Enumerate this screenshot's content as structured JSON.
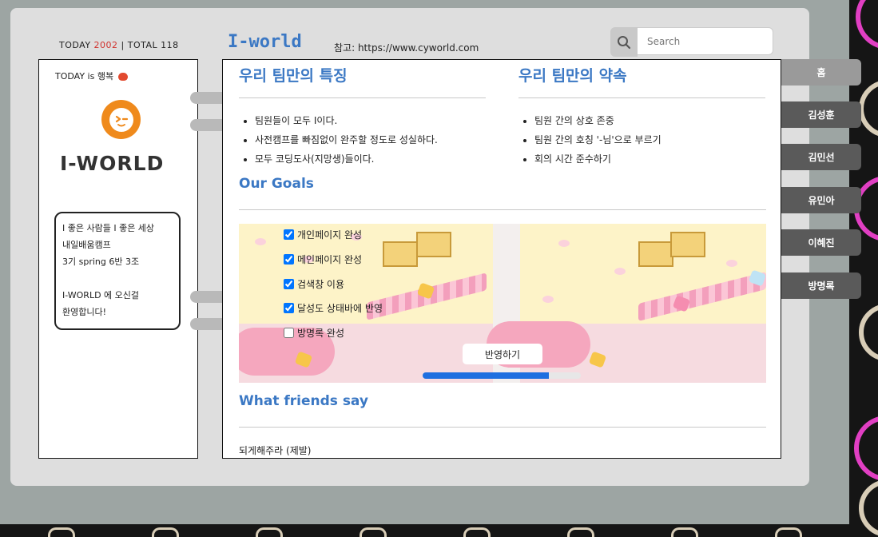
{
  "header": {
    "today_label": "TODAY",
    "today_count": "2002",
    "separator": "|",
    "total_label": "TOTAL",
    "total_count": "118",
    "site_title": "I-world",
    "reference": "참고: https://www.cyworld.com"
  },
  "search": {
    "placeholder": "Search",
    "icon": "search-icon"
  },
  "left_panel": {
    "today_mood": "TODAY is 행복",
    "logo_text": "I-WORLD",
    "intro_lines": [
      "I 좋은 사람들 I 좋은 세상",
      "내일배움캠프",
      "3기 spring 6반 3조",
      "",
      "I-WORLD 에 오신걸",
      "환영합니다!"
    ]
  },
  "main": {
    "feature_title": "우리 팀만의 특징",
    "features": [
      "팀원들이 모두 I이다.",
      "사전캠프를 빠짐없이 완주할 정도로 성실하다.",
      "모두 코딩도사(지망생)들이다."
    ],
    "promise_title": "우리 팀만의 약속",
    "promises": [
      "팀원 간의 상호 존중",
      "팀원 간의 호칭 '-님'으로 부르기",
      "회의 시간 준수하기"
    ],
    "goals_title": "Our Goals",
    "goals": [
      {
        "label": "개인페이지 완성",
        "checked": true
      },
      {
        "label": "메인페이지 완성",
        "checked": true
      },
      {
        "label": "검색창 이용",
        "checked": true
      },
      {
        "label": "달성도 상태바에 반영",
        "checked": true
      },
      {
        "label": "방명록 완성",
        "checked": false
      }
    ],
    "apply_button": "반영하기",
    "progress": 0.8,
    "friends_title": "What friends say",
    "comment": "되게해주라 (제발)"
  },
  "nav": {
    "items": [
      "홈",
      "김성훈",
      "김민선",
      "유민아",
      "이혜진",
      "방명록"
    ]
  },
  "colors": {
    "accent": "#3b78c4",
    "today_count": "#d0312d",
    "logo_orange": "#ef8a1c",
    "nav_active": "#9a9a9a",
    "nav": "#5a5a5a",
    "progress": "#1e6fe0"
  }
}
